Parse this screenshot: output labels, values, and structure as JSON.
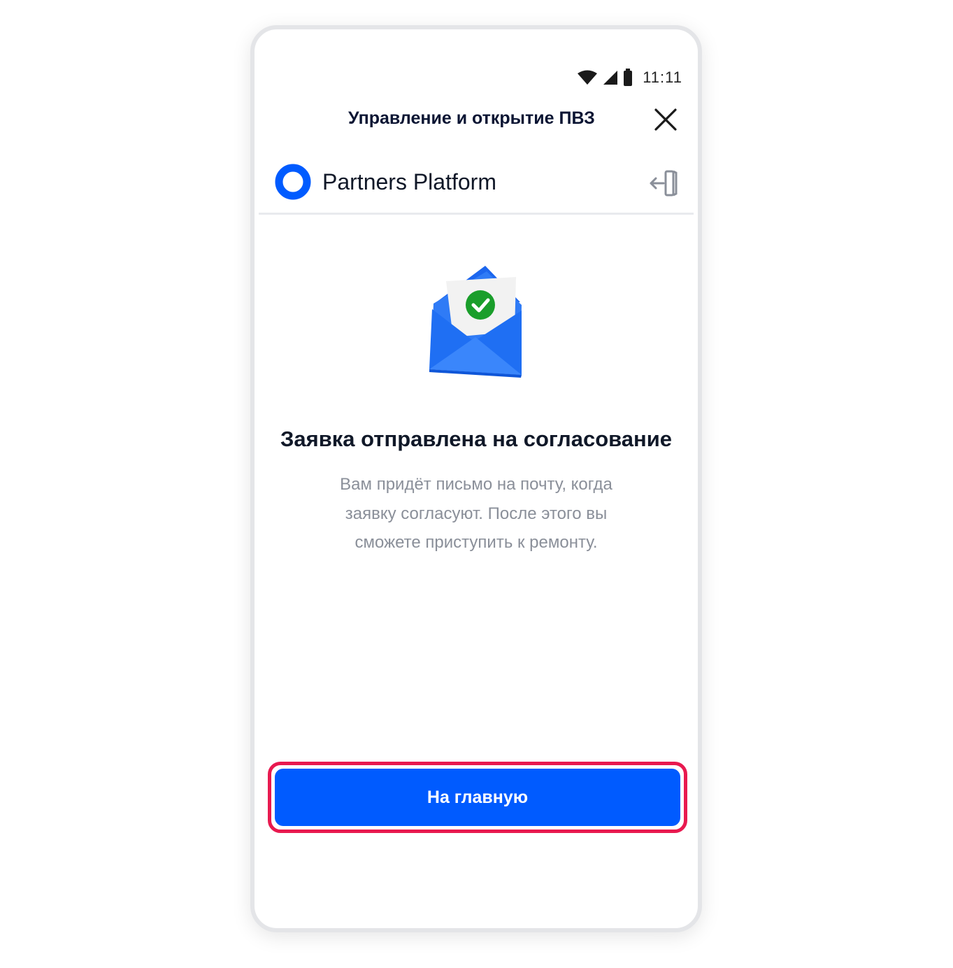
{
  "status_bar": {
    "time": "11:11",
    "icons": [
      "wifi-icon",
      "signal-icon",
      "battery-icon"
    ]
  },
  "modal": {
    "title": "Управление и открытие ПВЗ",
    "close_icon": "close-icon"
  },
  "app_bar": {
    "brand_name": "Partners Platform",
    "logo_icon": "ring-logo-icon",
    "logout_icon": "logout-icon"
  },
  "result": {
    "illustration": "envelope-check-icon",
    "title": "Заявка отправлена на согласование",
    "lines": [
      "Вам придёт письмо на почту, когда",
      "заявку согласуют. После этого вы",
      "сможете приступить к ремонту."
    ]
  },
  "actions": {
    "home_label": "На главную"
  },
  "colors": {
    "accent": "#005bff",
    "highlight": "#e8194f",
    "title_text": "#101828",
    "muted_text": "#8a8f99",
    "check_green": "#1a9e2b"
  }
}
